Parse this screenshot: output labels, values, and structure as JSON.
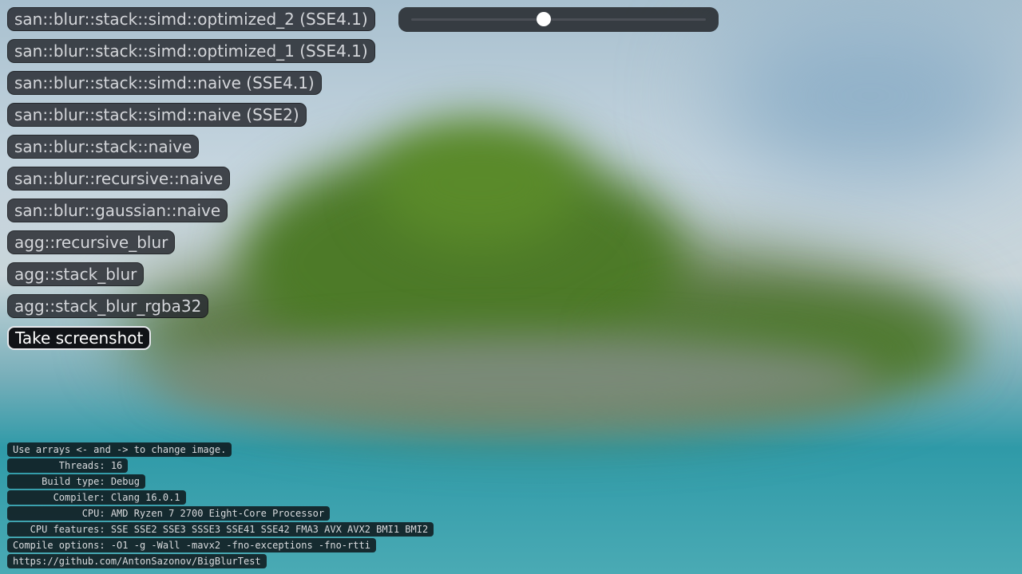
{
  "window": {
    "title": ""
  },
  "colors": {
    "button_bg": "#26292e",
    "button_text": "#d4d6da",
    "active_button_bg": "#111317",
    "active_border": "#e6e8ec",
    "slider_knob": "#ffffff"
  },
  "slider": {
    "value_fraction": 0.45
  },
  "buttons": [
    {
      "label": "san::blur::stack::simd::optimized_2 (SSE4.1)",
      "active": false
    },
    {
      "label": "san::blur::stack::simd::optimized_1 (SSE4.1)",
      "active": false
    },
    {
      "label": "san::blur::stack::simd::naive (SSE4.1)",
      "active": false
    },
    {
      "label": "san::blur::stack::simd::naive (SSE2)",
      "active": false
    },
    {
      "label": "san::blur::stack::naive",
      "active": false
    },
    {
      "label": "san::blur::recursive::naive",
      "active": false
    },
    {
      "label": "san::blur::gaussian::naive",
      "active": false
    },
    {
      "label": "agg::recursive_blur",
      "active": false
    },
    {
      "label": "agg::stack_blur",
      "active": false
    },
    {
      "label": "agg::stack_blur_rgba32",
      "active": false
    },
    {
      "label": "Take screenshot",
      "active": true
    }
  ],
  "info_lines": [
    "Use arrays <- and -> to change image.",
    "        Threads: 16",
    "     Build type: Debug",
    "       Compiler: Clang 16.0.1",
    "            CPU: AMD Ryzen 7 2700 Eight-Core Processor",
    "   CPU features: SSE SSE2 SSE3 SSSE3 SSE41 SSE42 FMA3 AVX AVX2 BMI1 BMI2",
    "Compile options: -O1 -g -Wall -mavx2 -fno-exceptions -fno-rtti",
    "https://github.com/AntonSazonov/BigBlurTest"
  ]
}
